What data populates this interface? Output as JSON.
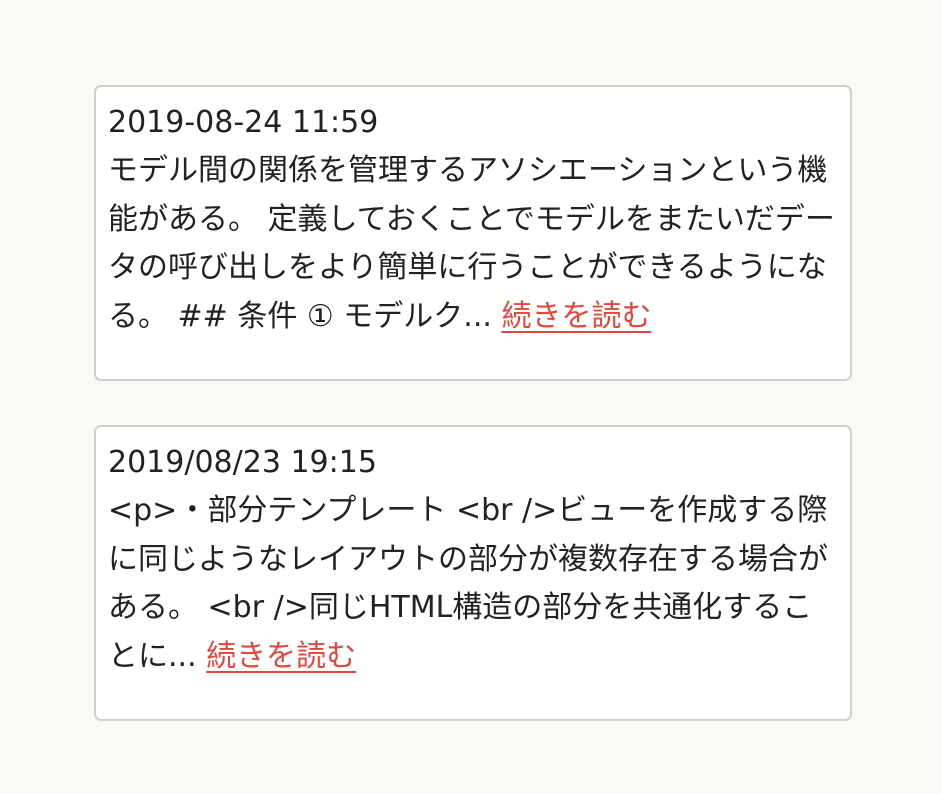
{
  "posts": [
    {
      "date": "2019-08-24 11:59",
      "excerpt": "モデル間の関係を管理するアソシエーションという機能がある。 定義しておくことでモデルをまたいだデータの呼び出しをより簡単に行うことができるようになる。 ## 条件 ① モデルク...",
      "read_more_label": "続きを読む"
    },
    {
      "date": "2019/08/23 19:15",
      "excerpt": "<p>・部分テンプレート <br />ビューを作成する際に同じようなレイアウトの部分が複数存在する場合がある。 <br />同じHTML構造の部分を共通化することに...",
      "read_more_label": "続きを読む"
    }
  ],
  "colors": {
    "page_background": "#faf9f5",
    "card_border": "#cfcfcf",
    "link": "#e1483d"
  }
}
